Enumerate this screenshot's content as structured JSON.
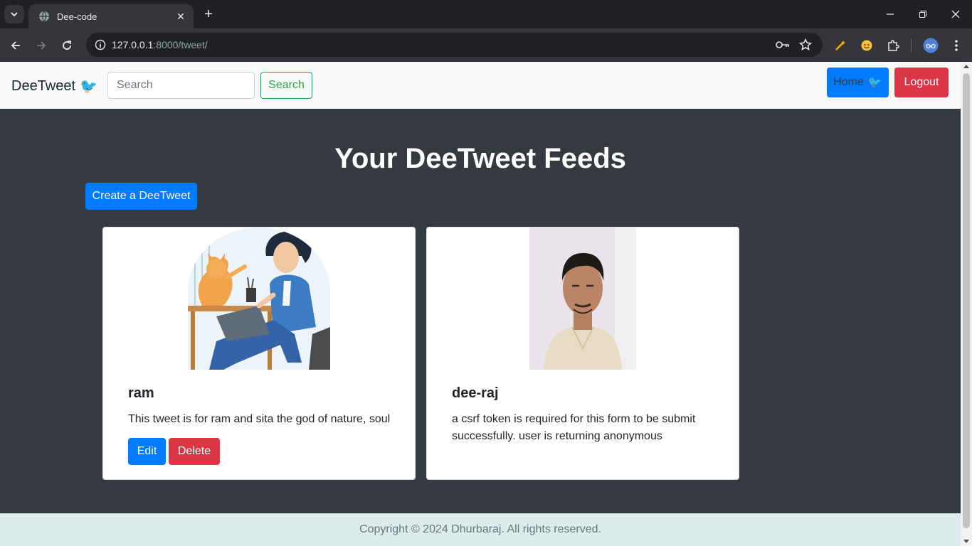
{
  "browser": {
    "tab_title": "Dee-code",
    "url_host": "127.0.0.1",
    "url_rest": ":8000/tweet/",
    "new_tab_label": "+",
    "tab_close_label": "✕"
  },
  "navbar": {
    "brand": "DeeTweet",
    "brand_emoji": "🐦",
    "search_placeholder": "Search",
    "search_button": "Search",
    "home_button": "Home",
    "home_emoji": "🐦",
    "logout_button": "Logout"
  },
  "main": {
    "title": "Your DeeTweet Feeds",
    "create_button": "Create a DeeTweet",
    "tweets": [
      {
        "user": "ram",
        "text": "This tweet is for ram and sita the god of nature, soul",
        "image": "cartoon-man-with-cat-illustration",
        "edit_label": "Edit",
        "delete_label": "Delete"
      },
      {
        "user": "dee-raj",
        "text": "a csrf token is required for this form to be submit successfully. user is returning anonymous",
        "image": "user-photo"
      }
    ]
  },
  "footer": {
    "text": "Copyright © 2024 Dhurbaraj. All rights reserved."
  },
  "colors": {
    "primary": "#007bff",
    "danger": "#dc3545",
    "success": "#28a745",
    "dark_bg": "#343a40",
    "footer_bg": "#dcecec"
  }
}
